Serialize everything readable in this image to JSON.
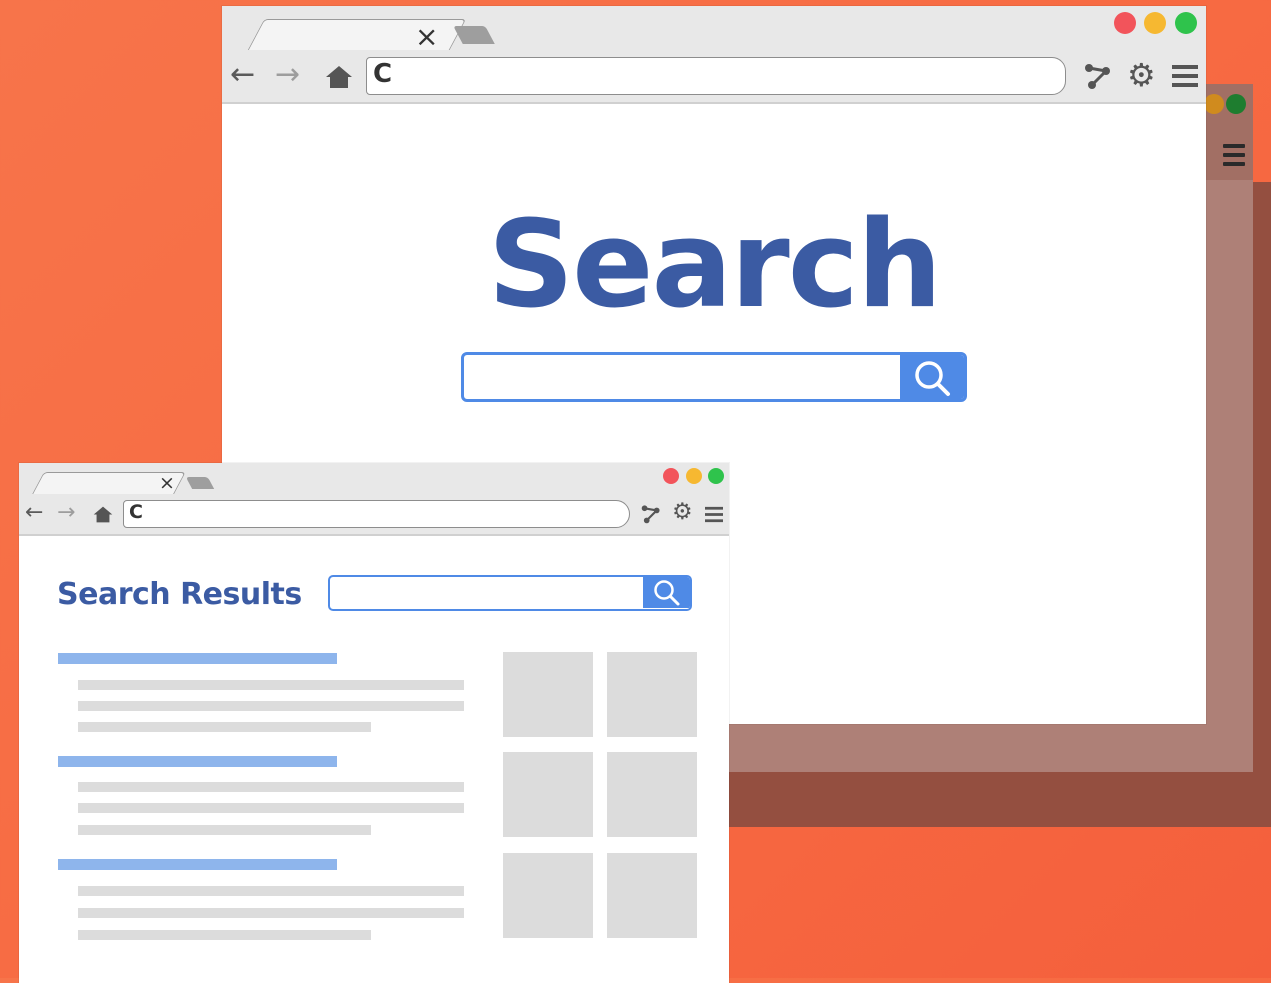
{
  "colors": {
    "background": "#f7744a",
    "accent_blue": "#4f8ae6",
    "title_blue": "#3b5ba3",
    "result_title_blue": "#8eb5ec",
    "placeholder_gray": "#dcdcdc",
    "traffic_red": "#f2545b",
    "traffic_yellow": "#f6b831",
    "traffic_green": "#2fc34c"
  },
  "main_window": {
    "tab_close_glyph": "×",
    "nav_back_icon": "arrow-left-icon",
    "nav_forward_icon": "arrow-right-icon",
    "home_icon": "home-icon",
    "reload_glyph": "C",
    "address_value": "",
    "toolbar_icons": [
      "share-icon",
      "gear-icon",
      "hamburger-menu-icon"
    ],
    "heading": "Search",
    "search": {
      "value": "",
      "button_icon": "magnifier-icon"
    }
  },
  "results_window": {
    "tab_close_glyph": "×",
    "reload_glyph": "C",
    "address_value": "",
    "heading": "Search Results",
    "search": {
      "value": "",
      "button_icon": "magnifier-icon"
    },
    "results": [
      {
        "title_bar": "result-title-placeholder",
        "lines": 3
      },
      {
        "title_bar": "result-title-placeholder",
        "lines": 3
      },
      {
        "title_bar": "result-title-placeholder",
        "lines": 3
      }
    ],
    "thumbnails": 6
  }
}
